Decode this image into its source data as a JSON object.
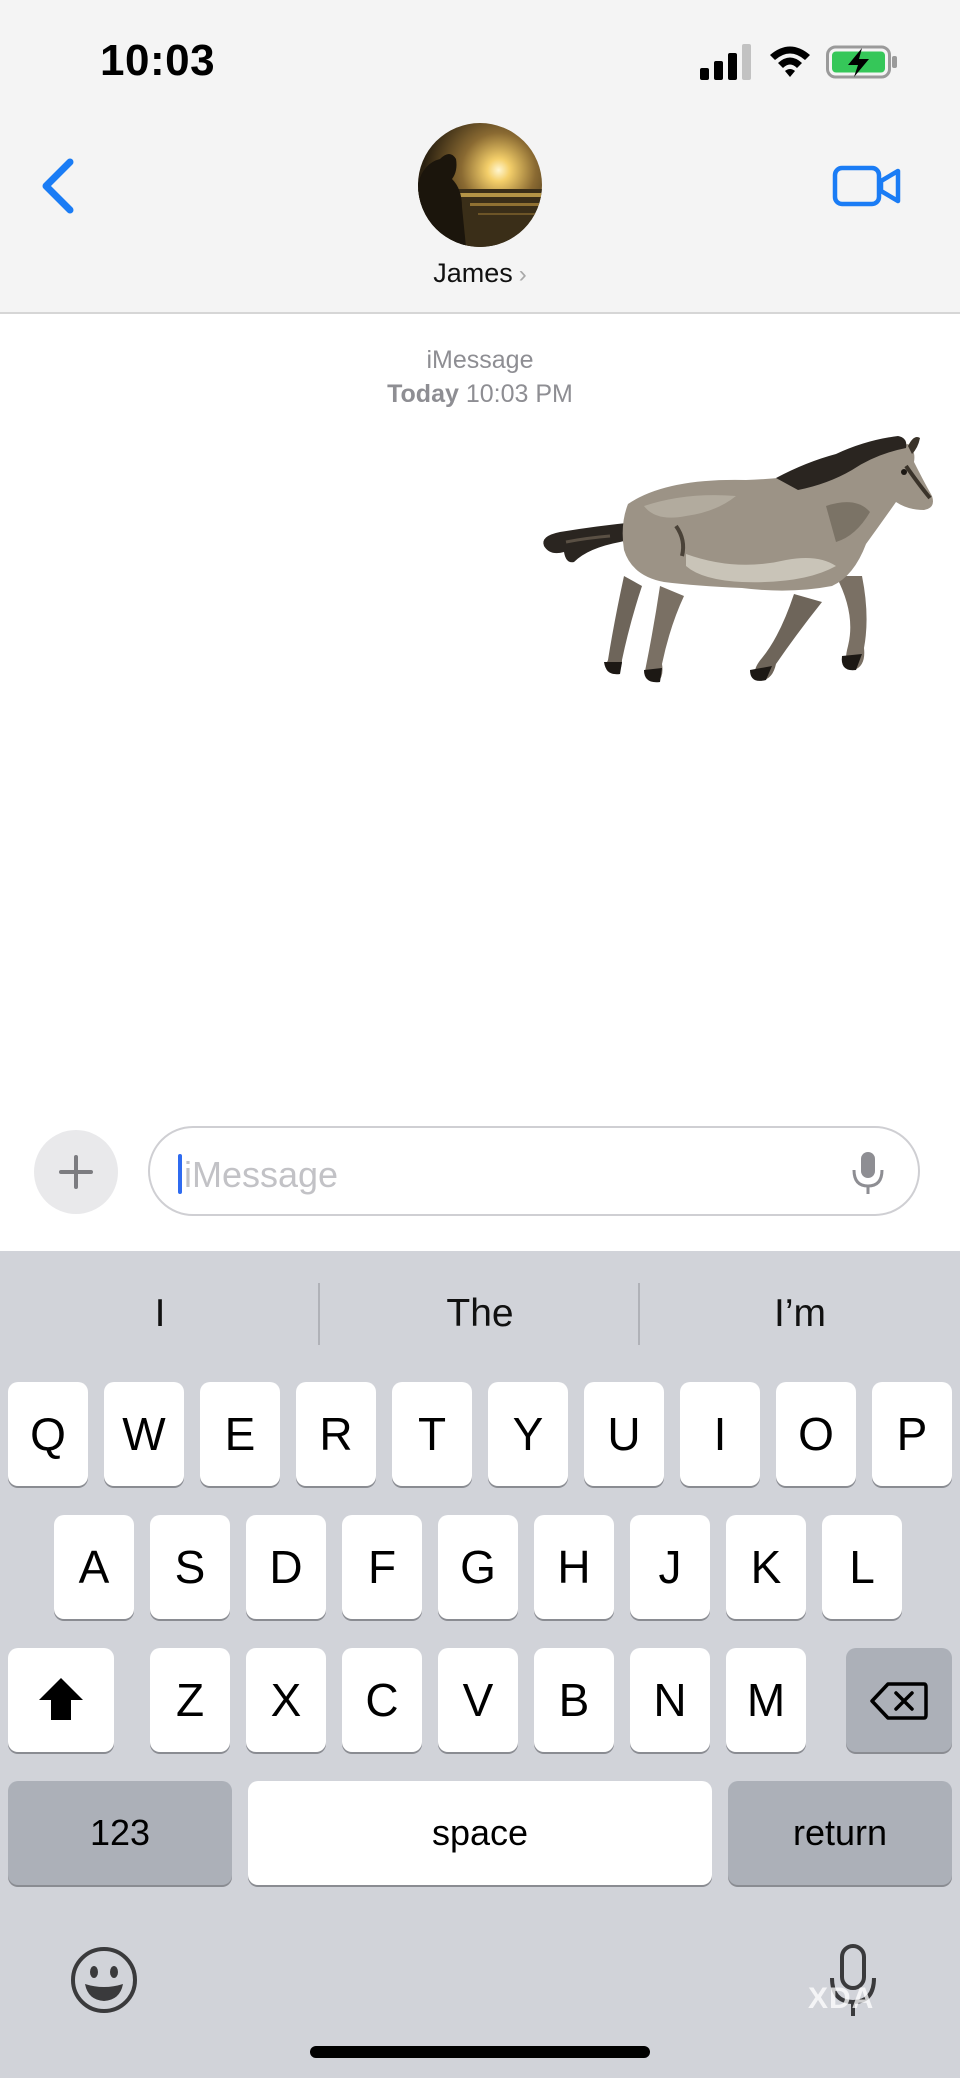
{
  "status_bar": {
    "time": "10:03",
    "signal_icon": "cellular-signal-icon",
    "wifi_icon": "wifi-icon",
    "battery_icon": "battery-charging-icon"
  },
  "header": {
    "contact_name": "James",
    "chevron": "›",
    "back_icon": "chevron-left-icon",
    "video_icon": "video-camera-icon",
    "accent_color": "#1a7cf5"
  },
  "conversation": {
    "service_label": "iMessage",
    "date_label": "Today",
    "time_label": "10:03 PM",
    "sticker": "horse-sticker"
  },
  "composer": {
    "placeholder": "iMessage",
    "plus_icon": "plus-icon",
    "mic_icon": "microphone-icon"
  },
  "keyboard": {
    "suggestions": [
      "I",
      "The",
      "I’m"
    ],
    "row1": [
      "Q",
      "W",
      "E",
      "R",
      "T",
      "Y",
      "U",
      "I",
      "O",
      "P"
    ],
    "row2": [
      "A",
      "S",
      "D",
      "F",
      "G",
      "H",
      "J",
      "K",
      "L"
    ],
    "row3": [
      "Z",
      "X",
      "C",
      "V",
      "B",
      "N",
      "M"
    ],
    "numbers_label": "123",
    "space_label": "space",
    "return_label": "return",
    "shift_icon": "shift-icon",
    "delete_icon": "delete-backspace-icon",
    "emoji_icon": "emoji-icon",
    "dictation_icon": "microphone-icon"
  }
}
